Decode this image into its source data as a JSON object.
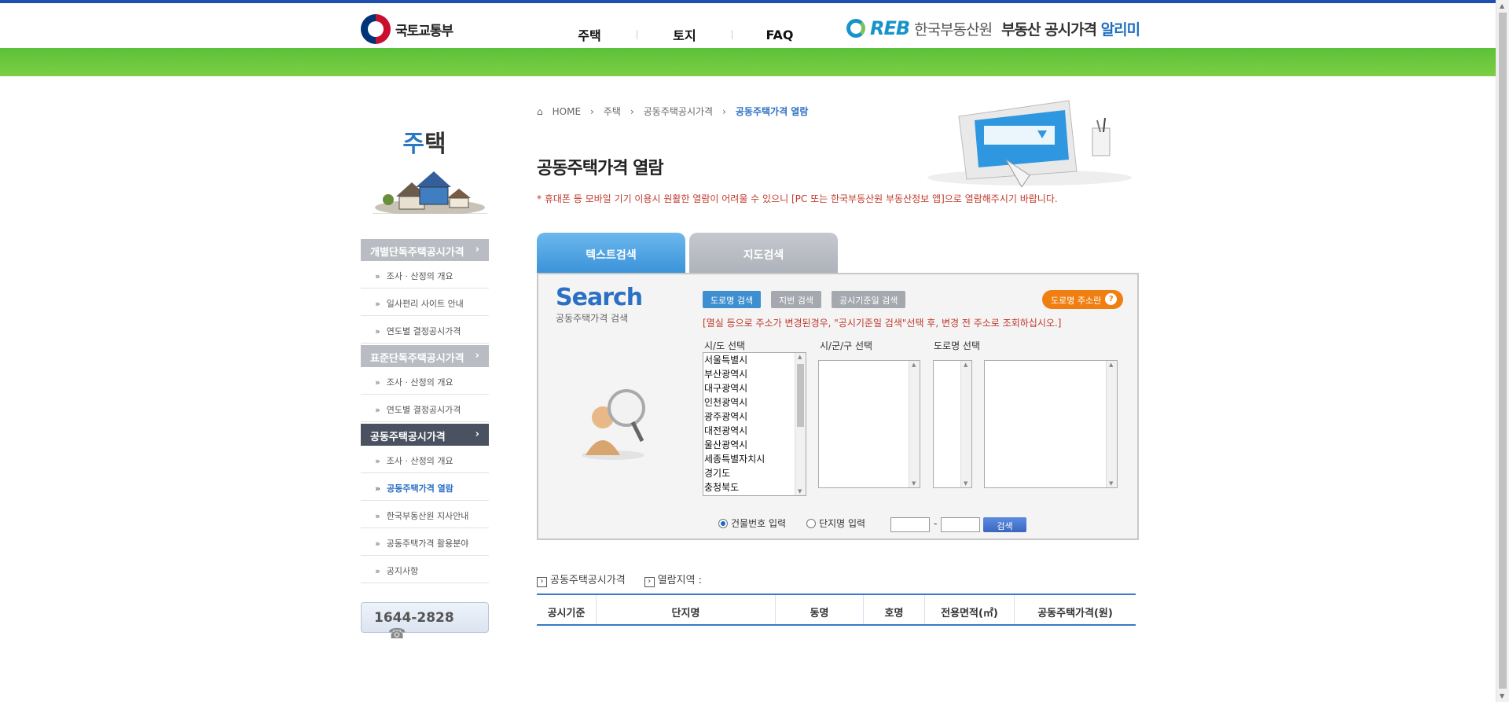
{
  "header": {
    "gov_name": "국토교통부",
    "nav": [
      "주택",
      "토지",
      "FAQ"
    ],
    "reb_mark": "REB",
    "reb_name": "한국부동산원",
    "reb_title_main": "부동산 공시가격",
    "reb_title_accent": "알리미"
  },
  "sidebar": {
    "title_first": "주",
    "title_rest": "택",
    "groups": [
      {
        "label": "개별단독주택공시가격",
        "active": false,
        "items": [
          {
            "label": "조사 · 산정의 개요",
            "on": false
          },
          {
            "label": "일사편리 사이트 안내",
            "on": false
          },
          {
            "label": "연도별 결정공시가격",
            "on": false
          }
        ]
      },
      {
        "label": "표준단독주택공시가격",
        "active": false,
        "items": [
          {
            "label": "조사 · 산정의 개요",
            "on": false
          },
          {
            "label": "연도별 결정공시가격",
            "on": false
          }
        ]
      },
      {
        "label": "공동주택공시가격",
        "active": true,
        "items": [
          {
            "label": "조사 · 산정의 개요",
            "on": false
          },
          {
            "label": "공동주택가격 열람",
            "on": true
          },
          {
            "label": "한국부동산원 지사안내",
            "on": false
          },
          {
            "label": "공동주택가격 활용분야",
            "on": false
          },
          {
            "label": "공지사항",
            "on": false
          }
        ]
      }
    ],
    "phone": "1644-2828"
  },
  "breadcrumb": [
    "HOME",
    "주택",
    "공동주택공시가격",
    "공동주택가격 열람"
  ],
  "page_title": "공동주택가격 열람",
  "notice": "* 휴대폰 등 모바일 기기 이용시 원활한 열람이 어려울 수 있으니 [PC 또는 한국부동산원 부동산정보 앱]으로 열람해주시기 바랍니다.",
  "tabs": [
    {
      "label": "텍스트검색",
      "active": true
    },
    {
      "label": "지도검색",
      "active": false
    }
  ],
  "search": {
    "logo": "Search",
    "logo_sub": "공동주택가격 검색",
    "btn_road": "도로명 검색",
    "btn_jibun": "지번 검색",
    "btn_date": "공시기준일 검색",
    "btn_road_info": "도로명 주소란",
    "warn": "[멸실 등으로 주소가 변경된경우, \"공시기준일 검색\"선택 후, 변경 전 주소로 조회하십시오.]",
    "label_sido": "시/도 선택",
    "label_sigungu": "시/군/구 선택",
    "label_road": "도로명 선택",
    "sido_options": [
      "서울특별시",
      "부산광역시",
      "대구광역시",
      "인천광역시",
      "광주광역시",
      "대전광역시",
      "울산광역시",
      "세종특별자치시",
      "경기도",
      "충청북도"
    ],
    "radio_building": "건물번호 입력",
    "radio_complex": "단지명 입력",
    "dash": "-",
    "btn_search": "검색"
  },
  "results": {
    "head1": "공동주택공시가격",
    "head2": "열람지역 :",
    "columns": [
      "공시기준",
      "단지명",
      "동명",
      "호명",
      "전용면적(㎡)",
      "공동주택가격(원)"
    ]
  }
}
